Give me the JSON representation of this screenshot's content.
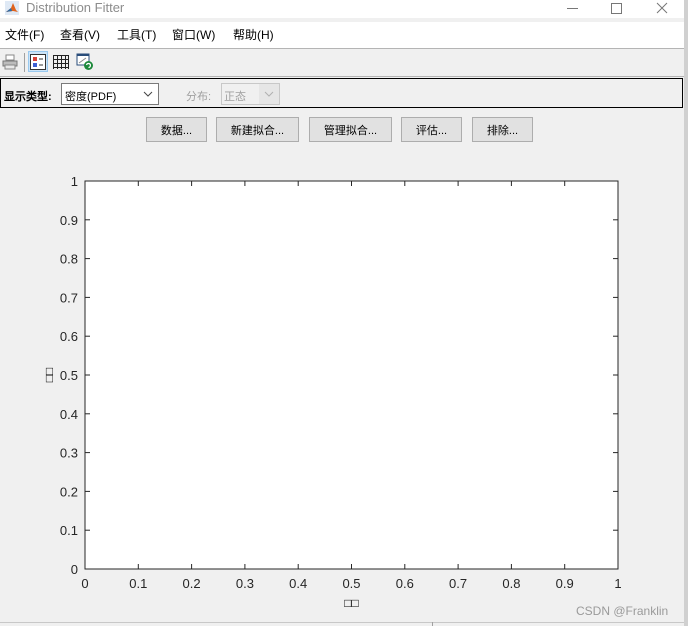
{
  "window": {
    "title": "Distribution Fitter",
    "icon": "matlab-icon",
    "controls": {
      "minimize": "—",
      "maximize": "☐",
      "close": "✕"
    }
  },
  "menubar": [
    {
      "label": "文件(F)"
    },
    {
      "label": "查看(V)"
    },
    {
      "label": "工具(T)"
    },
    {
      "label": "窗口(W)"
    },
    {
      "label": "帮助(H)"
    }
  ],
  "toolbar": [
    {
      "icon": "print-icon",
      "tooltip": ""
    },
    {
      "icon": "legend-toggle-icon",
      "active": true
    },
    {
      "icon": "grid-toggle-icon",
      "active": false
    },
    {
      "icon": "restore-axes-icon",
      "active": false
    }
  ],
  "controls": {
    "display_type_label": "显示类型:",
    "display_type_value": "密度(PDF)",
    "distribution_label": "分布:",
    "distribution_value": "正态",
    "distribution_enabled": false
  },
  "buttons": [
    {
      "label": "数据..."
    },
    {
      "label": "新建拟合..."
    },
    {
      "label": "管理拟合..."
    },
    {
      "label": "评估..."
    },
    {
      "label": "排除..."
    }
  ],
  "chart_data": {
    "type": "line",
    "title": "",
    "xlabel": "□□",
    "ylabel": "□□",
    "xlim": [
      0,
      1
    ],
    "ylim": [
      0,
      1
    ],
    "xticks": [
      "0",
      "0.1",
      "0.2",
      "0.3",
      "0.4",
      "0.5",
      "0.6",
      "0.7",
      "0.8",
      "0.9",
      "1"
    ],
    "yticks": [
      "0",
      "0.1",
      "0.2",
      "0.3",
      "0.4",
      "0.5",
      "0.6",
      "0.7",
      "0.8",
      "0.9",
      "1"
    ],
    "series": [],
    "grid": false,
    "box": true
  },
  "watermark": "CSDN @Franklin"
}
